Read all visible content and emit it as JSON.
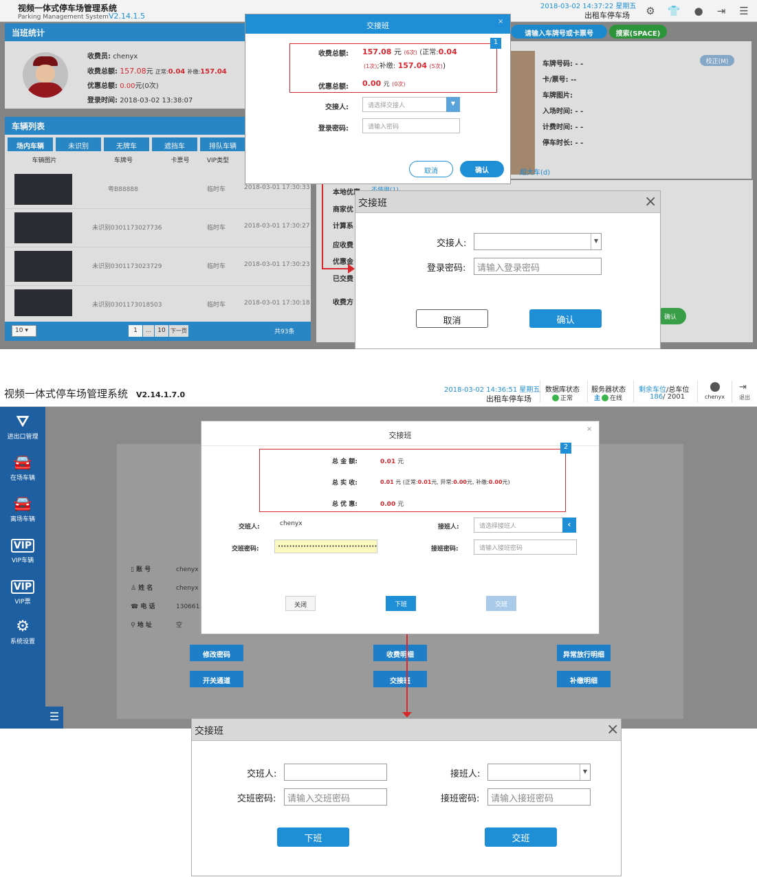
{
  "top": {
    "app_title": "视频一体式停车场管理系统",
    "app_subtitle": "Parking Management System",
    "version": "V2.14.1.5",
    "datetime": "2018-03-02 14:37:22 星期五",
    "lot_name": "出租车停车场",
    "shift_stats": {
      "title": "当班统计",
      "cashier_label": "收费员:",
      "cashier": "chenyx",
      "total_label": "收费总额:",
      "total_value": "157.08",
      "total_unit": "元",
      "normal_label": "正常:",
      "normal_value": "0.04",
      "supp_label": "补缴:",
      "supp_value": "157.04",
      "discount_label": "优惠总额:",
      "discount_value": "0.00",
      "discount_unit": "元(0次)",
      "login_label": "登录时间:",
      "login_time": "2018-03-02 13:38:07"
    },
    "vehicle_list": {
      "title": "车辆列表",
      "tabs": [
        "场内车辆",
        "未识别",
        "无牌车",
        "遮挡车",
        "排队车辆"
      ],
      "columns": [
        "车辆图片",
        "车牌号",
        "卡票号",
        "VIP类型"
      ],
      "rows": [
        {
          "plate": "粤B88888",
          "type": "临时车",
          "time": "2018-03-01 17:30:33"
        },
        {
          "plate": "未识别0301173027736",
          "type": "临时车",
          "time": "2018-03-01 17:30:27"
        },
        {
          "plate": "未识别0301173023729",
          "type": "临时车",
          "time": "2018-03-01 17:30:23"
        },
        {
          "plate": "未识别0301173018503",
          "type": "临时车",
          "time": "2018-03-01 17:30:18"
        }
      ],
      "page_size": "10",
      "page_num": "1",
      "page_ellipsis": "...",
      "page_last": "10",
      "next": "下一页",
      "total": "共93条"
    },
    "search_placeholder": "请输入车牌号或卡票号",
    "search_button": "搜索(SPACE)",
    "detail": {
      "plate": "车牌号码: - -",
      "card": "卡/票号: --",
      "image": "车牌图片:",
      "entry": "入场时间: - -",
      "charge": "计费时间: - -",
      "duration": "停车时长: - -",
      "correct": "校正(M)",
      "big_car": "超大车(d)"
    },
    "mid_labels": [
      "本地优惠",
      "商家优",
      "计算系",
      "应收费",
      "优惠金",
      "已交费",
      "收费方"
    ],
    "mid_option": "不使用(1)",
    "confirm_right": "确认",
    "small_dialog": {
      "title": "交接班",
      "total_label": "收费总额:",
      "total": "157.08",
      "unit": "元",
      "count1": "(6次)",
      "normal_label": "(正常:",
      "normal": "0.04",
      "count2": "(1次)",
      "supp_label": ";补缴:",
      "supp": "157.04",
      "count3": "(5次)",
      "paren_close": ")",
      "discount_label": "优惠总额:",
      "discount": "0.00",
      "count4": "(0次)",
      "receiver_label": "交接人:",
      "receiver_placeholder": "请选择交接人",
      "password_label": "登录密码:",
      "password_placeholder": "请输入密码",
      "cancel": "取消",
      "confirm": "确认",
      "marker": "1"
    },
    "big_dialog": {
      "title": "交接班",
      "receiver_label": "交接人:",
      "password_label": "登录密码:",
      "password_placeholder": "请输入登录密码",
      "cancel": "取消",
      "confirm": "确认"
    }
  },
  "bottom": {
    "app_title": "视频一体式停车场管理系统",
    "version": "V2.14.1.7.0",
    "datetime": "2018-03-02 14:36:51 星期五",
    "lot_name": "出租车停车场",
    "db_label": "数据库状态",
    "db_status": "正常",
    "srv_label": "服务器状态",
    "srv_main": "主",
    "srv_status": "在线",
    "space_label_a": "剩余车位",
    "space_label_b": "/总车位",
    "space_value": "186",
    "space_total": "/ 2001",
    "user": "chenyx",
    "logout": "退出",
    "sidebar": [
      {
        "icon": "gate-icon",
        "label": "进出口管理"
      },
      {
        "icon": "car-icon",
        "label": "在场车辆"
      },
      {
        "icon": "car-leave-icon",
        "label": "离场车辆"
      },
      {
        "icon": "vip-icon",
        "label": "VIP车辆"
      },
      {
        "icon": "vip-ticket-icon",
        "label": "VIP票"
      },
      {
        "icon": "gear-icon",
        "label": "系统设置"
      }
    ],
    "profile": {
      "account_label": "账 号",
      "account": "chenyx",
      "name_label": "姓 名",
      "name": "chenyx",
      "phone_label": "电 话",
      "phone": "130661",
      "address_label": "地 址",
      "address": "空"
    },
    "actions": [
      "修改密码",
      "收费明细",
      "异常放行明细",
      "开关通道",
      "交接班",
      "补缴明细"
    ],
    "dialog": {
      "title": "交接班",
      "total_label": "总 金 额:",
      "total": "0.01",
      "total_unit": "元",
      "paid_label": "总 实 收:",
      "paid": "0.01",
      "paid_unit": "元",
      "normal_label": "(正常:",
      "normal": "0.01",
      "normal_unit": "元,",
      "abn_label": "异常:",
      "abn": "0.00",
      "abn_unit": "元,",
      "supp_label": "补缴:",
      "supp": "0.00",
      "supp_unit": "元)",
      "disc_label": "总 优 惠:",
      "disc": "0.00",
      "disc_unit": "元",
      "giver_label": "交班人:",
      "giver": "chenyx",
      "giver_pw_label": "交班密码:",
      "giver_pw": "••••••••••••••••••••••••••••••••••••••",
      "receiver_label": "接班人:",
      "receiver_placeholder": "请选择接班人",
      "receiver_pw_label": "接班密码:",
      "receiver_pw_placeholder": "请输入接班密码",
      "close": "关闭",
      "offduty": "下班",
      "handover": "交班",
      "marker": "2"
    },
    "big_dialog": {
      "title": "交接班",
      "giver_label": "交班人:",
      "giver_pw_label": "交班密码:",
      "giver_pw_placeholder": "请输入交班密码",
      "receiver_label": "接班人:",
      "receiver_pw_label": "接班密码:",
      "receiver_pw_placeholder": "请输入接班密码",
      "offduty": "下班",
      "handover": "交班"
    }
  },
  "colors": {
    "accent": "#1e8fd6",
    "red": "#d9272e",
    "sidebar": "#1d5fa1"
  }
}
